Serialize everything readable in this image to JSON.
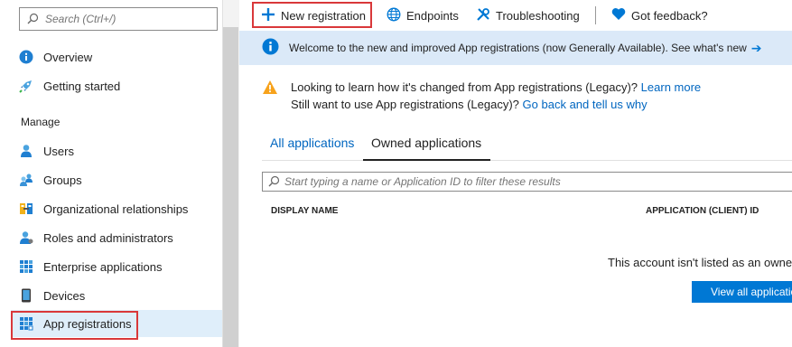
{
  "sidebar": {
    "search_placeholder": "Search (Ctrl+/)",
    "collapse_glyph": "«",
    "section_manage": "Manage",
    "items": [
      {
        "label": "Overview",
        "icon": "info-icon"
      },
      {
        "label": "Getting started",
        "icon": "rocket-icon"
      },
      {
        "label": "Users",
        "icon": "user-icon"
      },
      {
        "label": "Groups",
        "icon": "group-icon"
      },
      {
        "label": "Organizational relationships",
        "icon": "org-relationships-icon"
      },
      {
        "label": "Roles and administrators",
        "icon": "roles-icon"
      },
      {
        "label": "Enterprise applications",
        "icon": "enterprise-apps-icon"
      },
      {
        "label": "Devices",
        "icon": "device-icon"
      },
      {
        "label": "App registrations",
        "icon": "app-registrations-icon",
        "active": true
      }
    ]
  },
  "toolbar": {
    "new_registration": "New registration",
    "endpoints": "Endpoints",
    "troubleshooting": "Troubleshooting",
    "feedback": "Got feedback?"
  },
  "banner": {
    "text": "Welcome to the new and improved App registrations (now Generally Available). See what's new",
    "arrow": "➔"
  },
  "legacy_notice": {
    "line1_text": "Looking to learn how it's changed from App registrations (Legacy)?",
    "line1_link": "Learn more",
    "line2_text": "Still want to use App registrations (Legacy)?",
    "line2_link": "Go back and tell us why"
  },
  "tabs": {
    "all": "All applications",
    "owned": "Owned applications"
  },
  "filter": {
    "placeholder": "Start typing a name or Application ID to filter these results"
  },
  "table": {
    "col_display_name": "DISPLAY NAME",
    "col_app_id": "APPLICATION (CLIENT) ID"
  },
  "empty": {
    "message": "This account isn't listed as an owne",
    "button": "View all applicatio"
  },
  "colors": {
    "accent": "#0078d4",
    "banner_bg": "#dbe9f8",
    "highlight": "#d9383a",
    "warning": "#f7a21b"
  }
}
